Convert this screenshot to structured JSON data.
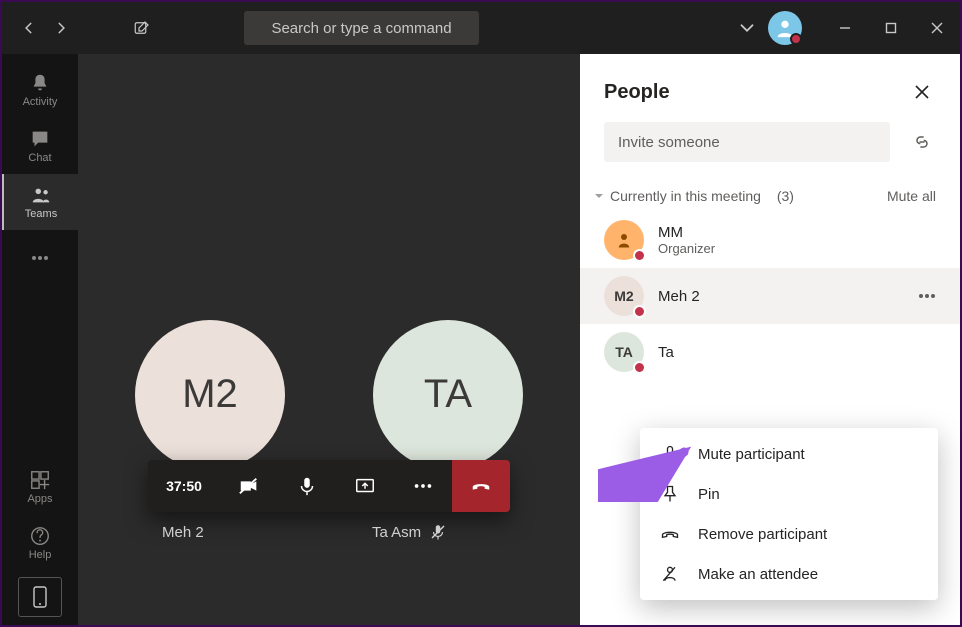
{
  "titlebar": {
    "search_placeholder": "Search or type a command"
  },
  "rail": {
    "activity": "Activity",
    "chat": "Chat",
    "teams": "Teams",
    "apps": "Apps",
    "help": "Help"
  },
  "meeting": {
    "avatars": {
      "m2": "M2",
      "ta": "TA"
    },
    "timer": "37:50",
    "names": {
      "left": "Meh 2",
      "right": "Ta Asm"
    }
  },
  "panel": {
    "title": "People",
    "invite_placeholder": "Invite someone",
    "section_label": "Currently in this meeting",
    "section_count": "(3)",
    "mute_all": "Mute all",
    "participants": [
      {
        "initials": "",
        "name": "MM",
        "sub": "Organizer",
        "avatar_class": "pav-mm"
      },
      {
        "initials": "M2",
        "name": "Meh 2",
        "sub": "",
        "avatar_class": "pav-m2"
      },
      {
        "initials": "TA",
        "name": "Ta",
        "sub": "",
        "avatar_class": "pav-ta"
      }
    ],
    "menu": {
      "mute": "Mute participant",
      "pin": "Pin",
      "remove": "Remove participant",
      "attendee": "Make an attendee"
    }
  }
}
